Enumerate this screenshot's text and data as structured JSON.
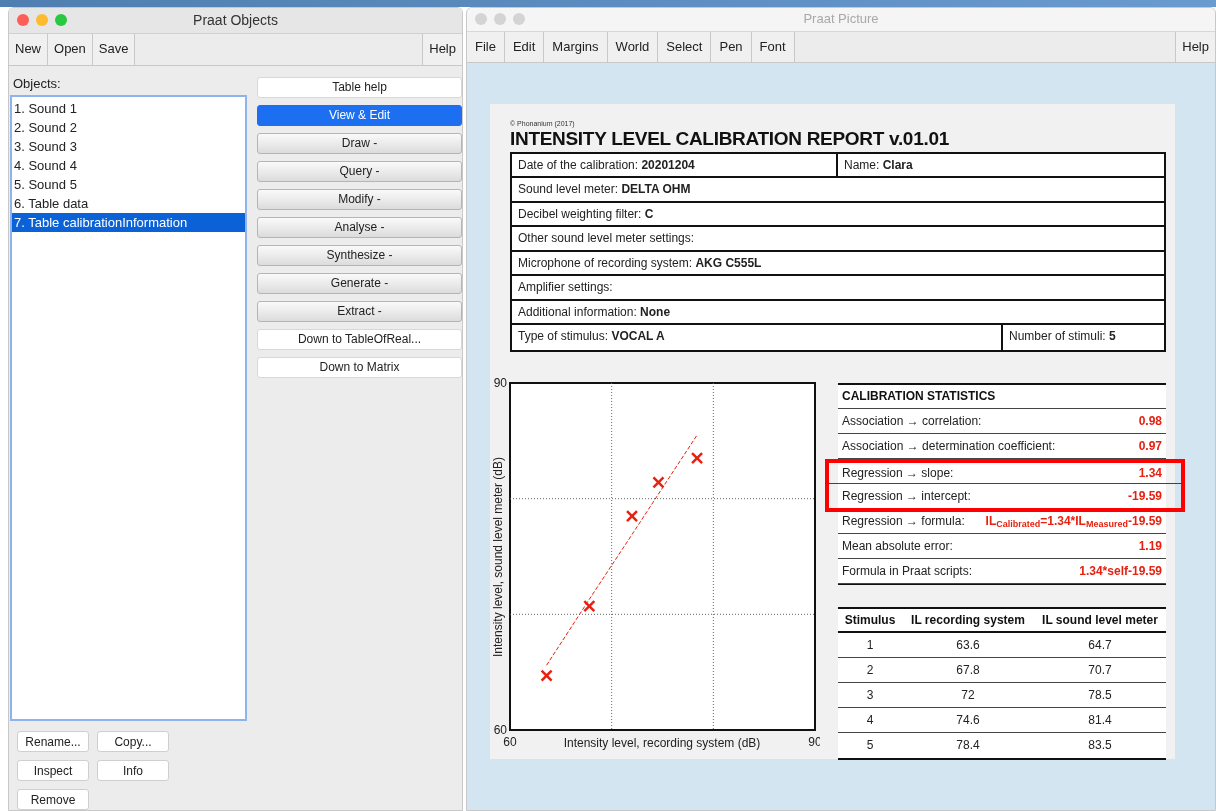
{
  "objects_window": {
    "title": "Praat Objects",
    "toolbar": [
      "New",
      "Open",
      "Save"
    ],
    "help": "Help",
    "list_label": "Objects:",
    "objects": [
      {
        "label": "1. Sound 1",
        "selected": false
      },
      {
        "label": "2. Sound 2",
        "selected": false
      },
      {
        "label": "3. Sound 3",
        "selected": false
      },
      {
        "label": "4. Sound 4",
        "selected": false
      },
      {
        "label": "5. Sound 5",
        "selected": false
      },
      {
        "label": "6. Table data",
        "selected": false
      },
      {
        "label": "7. Table calibrationInformation",
        "selected": true
      }
    ],
    "actions": [
      {
        "label": "Table help",
        "kind": "action",
        "selected": false
      },
      {
        "label": "View & Edit",
        "kind": "action",
        "selected": true
      },
      {
        "label": "Draw -",
        "kind": "menu",
        "selected": false
      },
      {
        "label": "Query -",
        "kind": "menu",
        "selected": false
      },
      {
        "label": "Modify -",
        "kind": "menu",
        "selected": false
      },
      {
        "label": "Analyse -",
        "kind": "menu",
        "selected": false
      },
      {
        "label": "Synthesize -",
        "kind": "menu",
        "selected": false
      },
      {
        "label": "Generate -",
        "kind": "menu",
        "selected": false
      },
      {
        "label": "Extract -",
        "kind": "menu",
        "selected": false
      },
      {
        "label": "Down to TableOfReal...",
        "kind": "action",
        "selected": false
      },
      {
        "label": "Down to Matrix",
        "kind": "action",
        "selected": false
      }
    ],
    "bottom_buttons": [
      "Rename...",
      "Copy...",
      "Inspect",
      "Info",
      "Remove"
    ]
  },
  "picture_window": {
    "title": "Praat Picture",
    "menus": [
      "File",
      "Edit",
      "Margins",
      "World",
      "Select",
      "Pen",
      "Font"
    ],
    "help": "Help",
    "report": {
      "copyright": "© Phonanium (2017)",
      "title": "INTENSITY LEVEL CALIBRATION REPORT v.01.01",
      "rows": [
        [
          "Date of the calibration: **20201204**",
          "Name: **Clara**"
        ],
        [
          "Sound level meter: **DELTA OHM**"
        ],
        [
          "Decibel weighting filter: **C**"
        ],
        [
          "Other sound level meter settings:"
        ],
        [
          "Microphone of recording system: **AKG C555L**"
        ],
        [
          "Amplifier settings:"
        ],
        [
          "Additional information: **None**"
        ],
        [
          "Type of stimulus: **VOCAL A**",
          "Number of stimuli: **5**"
        ]
      ],
      "chart_data": {
        "type": "scatter",
        "xlabel": "Intensity level, recording system (dB)",
        "ylabel": "Intensity level, sound level meter (dB)",
        "x": [
          63.6,
          67.8,
          72,
          74.6,
          78.4
        ],
        "series": [
          {
            "color": "#e8200f",
            "values": [
              64.7,
              70.7,
              78.5,
              81.4,
              83.5
            ]
          },
          {
            "type": "line",
            "line_style": "dashed",
            "color": "#e8200f",
            "values": [
              65.6,
              71.3,
              76.9,
              80.4,
              85.5
            ]
          }
        ],
        "xlim": [
          60,
          90
        ],
        "ylim": [
          60,
          90
        ],
        "xticks": [
          60,
          90
        ],
        "yticks": [
          60,
          90
        ]
      },
      "stats": {
        "title": "CALIBRATION STATISTICS",
        "rows": [
          {
            "label": "Association → correlation:",
            "value": "0.98",
            "highlighted": false
          },
          {
            "label": "Association → determination coefficient:",
            "value": "0.97",
            "highlighted": false
          },
          {
            "label": "Regression → slope:",
            "value": "1.34",
            "highlighted": true
          },
          {
            "label": "Regression → intercept:",
            "value": "-19.59",
            "highlighted": true
          },
          {
            "label": "Regression → formula:",
            "value": "IL$_{Calibrated}$=1.34*IL$_{Measured}$-19.59",
            "highlighted": false
          },
          {
            "label": "Mean absolute error:",
            "value": "1.19",
            "highlighted": false
          },
          {
            "label": "Formula in Praat scripts:",
            "value": "1.34*self-19.59",
            "highlighted": false
          }
        ]
      },
      "data_table": {
        "columns": [
          "Stimulus",
          "IL recording system",
          "IL sound level meter"
        ],
        "rows": [
          [
            "1",
            "63.6",
            "64.7"
          ],
          [
            "2",
            "67.8",
            "70.7"
          ],
          [
            "3",
            "72",
            "78.5"
          ],
          [
            "4",
            "74.6",
            "81.4"
          ],
          [
            "5",
            "78.4",
            "83.5"
          ]
        ]
      }
    }
  }
}
